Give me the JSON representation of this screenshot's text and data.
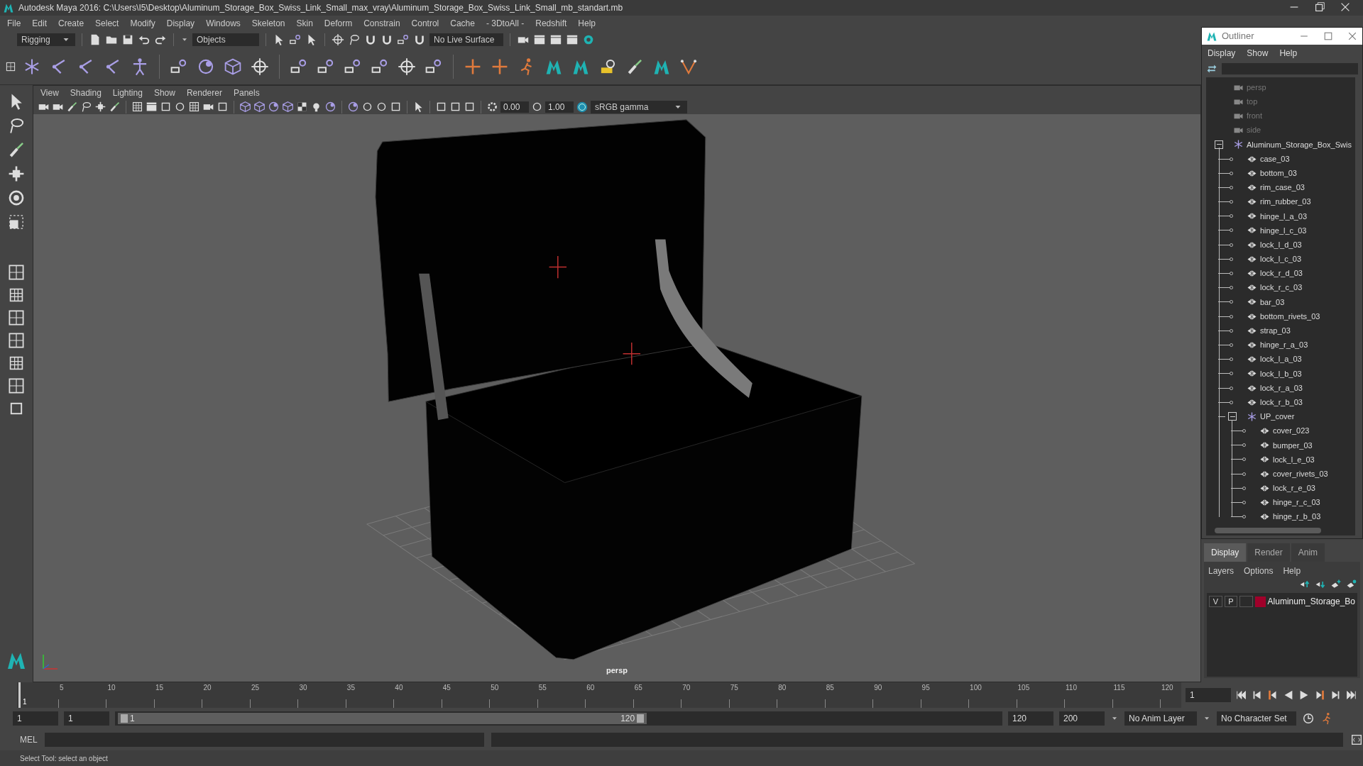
{
  "window": {
    "title": "Autodesk Maya 2016: C:\\Users\\I5\\Desktop\\Aluminum_Storage_Box_Swiss_Link_Small_max_vray\\Aluminum_Storage_Box_Swiss_Link_Small_mb_standart.mb"
  },
  "menu_bar": [
    "File",
    "Edit",
    "Create",
    "Select",
    "Modify",
    "Display",
    "Windows",
    "Skeleton",
    "Skin",
    "Deform",
    "Constrain",
    "Control",
    "Cache",
    "- 3DtoAll -",
    "Redshift",
    "Help"
  ],
  "status_line": {
    "menu_set": "Rigging",
    "selection_mode": "Objects",
    "live_surface": "No Live Surface"
  },
  "viewport": {
    "menu": [
      "View",
      "Shading",
      "Lighting",
      "Show",
      "Renderer",
      "Panels"
    ],
    "exposure": "0.00",
    "gamma": "1.00",
    "color_space": "sRGB gamma",
    "camera_label": "persp"
  },
  "outliner": {
    "title": "Outliner",
    "menu": [
      "Display",
      "Show",
      "Help"
    ],
    "items": [
      {
        "label": "persp",
        "kind": "camera"
      },
      {
        "label": "top",
        "kind": "camera"
      },
      {
        "label": "front",
        "kind": "camera"
      },
      {
        "label": "side",
        "kind": "camera"
      },
      {
        "label": "Aluminum_Storage_Box_Swis",
        "kind": "group",
        "expanded": true,
        "children": [
          {
            "label": "case_03",
            "kind": "mesh"
          },
          {
            "label": "bottom_03",
            "kind": "mesh"
          },
          {
            "label": "rim_case_03",
            "kind": "mesh"
          },
          {
            "label": "rim_rubber_03",
            "kind": "mesh"
          },
          {
            "label": "hinge_l_a_03",
            "kind": "mesh"
          },
          {
            "label": "hinge_l_c_03",
            "kind": "mesh"
          },
          {
            "label": "lock_l_d_03",
            "kind": "mesh"
          },
          {
            "label": "lock_l_c_03",
            "kind": "mesh"
          },
          {
            "label": "lock_r_d_03",
            "kind": "mesh"
          },
          {
            "label": "lock_r_c_03",
            "kind": "mesh"
          },
          {
            "label": "bar_03",
            "kind": "mesh"
          },
          {
            "label": "bottom_rivets_03",
            "kind": "mesh"
          },
          {
            "label": "strap_03",
            "kind": "mesh"
          },
          {
            "label": "hinge_r_a_03",
            "kind": "mesh"
          },
          {
            "label": "lock_l_a_03",
            "kind": "mesh"
          },
          {
            "label": "lock_l_b_03",
            "kind": "mesh"
          },
          {
            "label": "lock_r_a_03",
            "kind": "mesh"
          },
          {
            "label": "lock_r_b_03",
            "kind": "mesh"
          },
          {
            "label": "UP_cover",
            "kind": "group",
            "expanded": true,
            "children": [
              {
                "label": "cover_023",
                "kind": "mesh"
              },
              {
                "label": "bumper_03",
                "kind": "mesh"
              },
              {
                "label": "lock_l_e_03",
                "kind": "mesh"
              },
              {
                "label": "cover_rivets_03",
                "kind": "mesh"
              },
              {
                "label": "lock_r_e_03",
                "kind": "mesh"
              },
              {
                "label": "hinge_r_c_03",
                "kind": "mesh"
              },
              {
                "label": "hinge_r_b_03",
                "kind": "mesh"
              }
            ]
          }
        ]
      }
    ]
  },
  "layer_editor": {
    "tabs": [
      {
        "label": "Display",
        "selected": true
      },
      {
        "label": "Render",
        "selected": false
      },
      {
        "label": "Anim",
        "selected": false
      }
    ],
    "menu": [
      "Layers",
      "Options",
      "Help"
    ],
    "layers": [
      {
        "visibility": "V",
        "playback": "P",
        "color": "#a0002a",
        "name": "Aluminum_Storage_Bo"
      }
    ]
  },
  "timeline": {
    "start_label": "1",
    "ticks": [
      "5",
      "10",
      "15",
      "20",
      "25",
      "30",
      "35",
      "40",
      "45",
      "50",
      "55",
      "60",
      "65",
      "70",
      "75",
      "80",
      "85",
      "90",
      "95",
      "100",
      "105",
      "110",
      "115",
      "120"
    ],
    "current_frame": "1"
  },
  "range": {
    "start": "1",
    "playback_start": "1",
    "slider_start": "1",
    "slider_end": "120",
    "level": 0.6,
    "playback_end": "120",
    "end": "200",
    "anim_layer": "No Anim Layer",
    "character_set": "No Character Set"
  },
  "command_line": {
    "language": "MEL"
  },
  "help_line": "Select Tool: select an object"
}
